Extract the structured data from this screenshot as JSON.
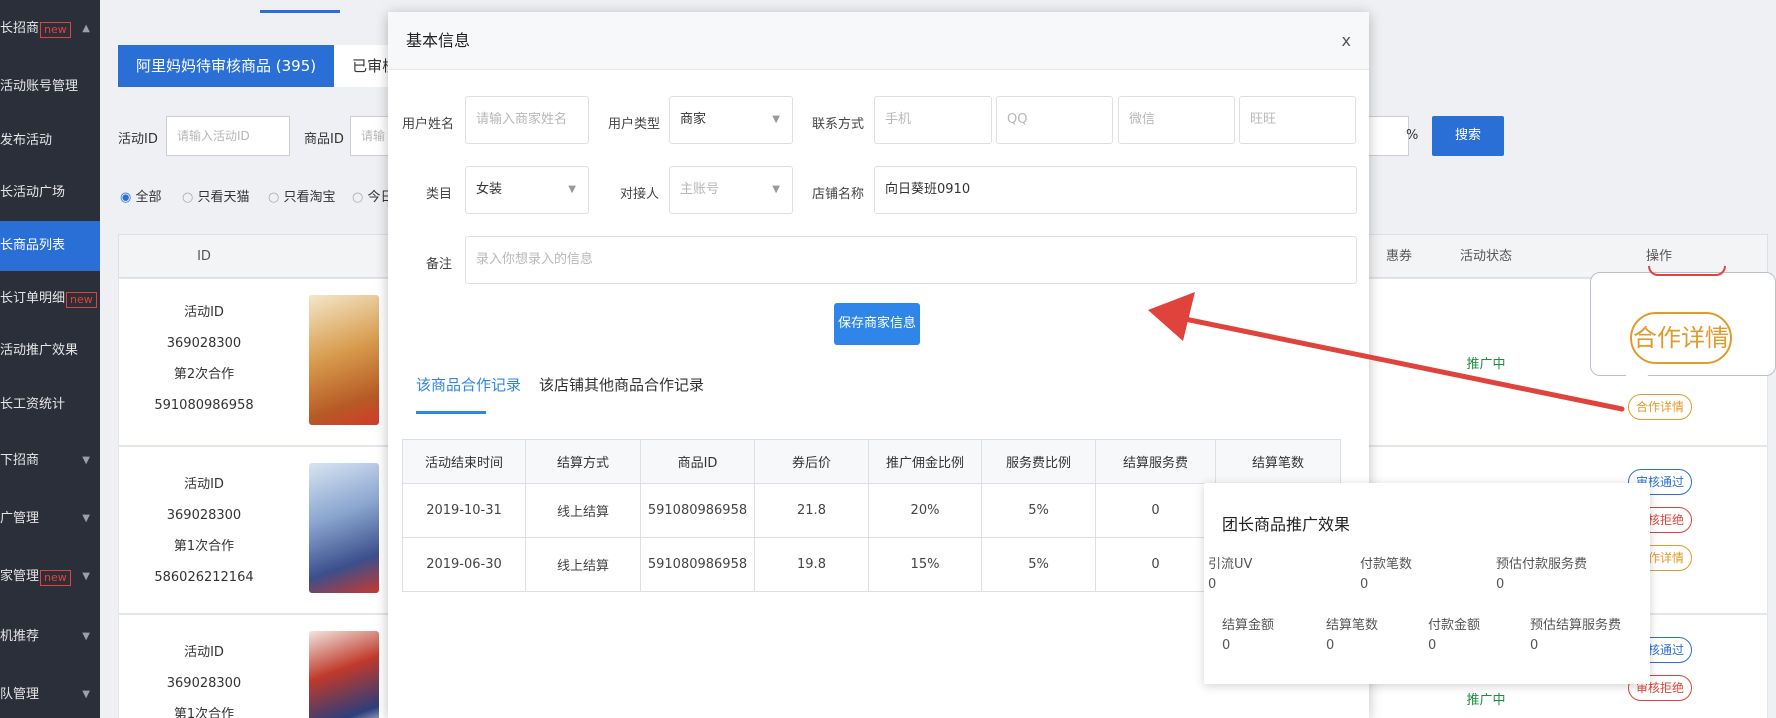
{
  "sidebar": {
    "items": [
      {
        "label": "长招商",
        "badge": "new",
        "caret": "▲",
        "active": false
      },
      {
        "label": "活动账号管理",
        "badge": "",
        "caret": "",
        "active": false
      },
      {
        "label": "发布活动",
        "badge": "",
        "caret": "",
        "active": false
      },
      {
        "label": "长活动广场",
        "badge": "",
        "caret": "",
        "active": false
      },
      {
        "label": "长商品列表",
        "badge": "",
        "caret": "",
        "active": true
      },
      {
        "label": "长订单明细",
        "badge": "new",
        "caret": "",
        "active": false
      },
      {
        "label": "活动推广效果",
        "badge": "",
        "caret": "",
        "active": false
      },
      {
        "label": "长工资统计",
        "badge": "",
        "caret": "",
        "active": false
      },
      {
        "label": "下招商",
        "badge": "",
        "caret": "▼",
        "active": false
      },
      {
        "label": "广管理",
        "badge": "",
        "caret": "▼",
        "active": false
      },
      {
        "label": "家管理",
        "badge": "new",
        "caret": "▼",
        "active": false
      },
      {
        "label": "机推荐",
        "badge": "",
        "caret": "▼",
        "active": false
      },
      {
        "label": "队管理",
        "badge": "",
        "caret": "▼",
        "active": false
      }
    ]
  },
  "background": {
    "tabs": [
      "阿里妈妈待审核商品 (395)",
      "已审核未"
    ],
    "filters": {
      "activity_id_label": "活动ID",
      "activity_id_placeholder": "请输入活动ID",
      "product_id_label": "商品ID",
      "product_id_placeholder": "请输",
      "percent": "%",
      "search_label": "搜索"
    },
    "radios": [
      "全部",
      "只看天猫",
      "只看淘宝",
      "今日"
    ],
    "headers": {
      "id": "ID",
      "coupon": "惠券",
      "status": "活动状态",
      "actions": "操作"
    },
    "rows": [
      {
        "lines": [
          "活动ID",
          "369028300",
          "第2次合作",
          "591080986958"
        ],
        "status": "推广中",
        "actions": [
          "合作详情"
        ]
      },
      {
        "lines": [
          "活动ID",
          "369028300",
          "第1次合作",
          "586026212164"
        ],
        "status": "",
        "actions": [
          "审核通过",
          "审核拒绝",
          "合作详情"
        ]
      },
      {
        "lines": [
          "活动ID",
          "369028300",
          "第1次合作"
        ],
        "status": "推广中",
        "actions": [
          "审核通过",
          "审核拒绝"
        ]
      }
    ],
    "callout_label": "合作详情"
  },
  "modal": {
    "title": "基本信息",
    "close": "x",
    "fields": {
      "username_label": "用户姓名",
      "username_placeholder": "请输入商家姓名",
      "user_type_label": "用户类型",
      "user_type_value": "商家",
      "contact_label": "联系方式",
      "phone_placeholder": "手机",
      "qq_placeholder": "QQ",
      "wechat_placeholder": "微信",
      "wangwang_placeholder": "旺旺",
      "category_label": "类目",
      "category_value": "女装",
      "contact_person_label": "对接人",
      "contact_person_placeholder": "主账号",
      "shop_name_label": "店铺名称",
      "shop_name_value": "向日葵班0910",
      "remark_label": "备注",
      "remark_placeholder": "录入你想录入的信息"
    },
    "save_label": "保存商家信息",
    "sub_tabs": [
      "该商品合作记录",
      "该店铺其他商品合作记录"
    ],
    "table": {
      "columns": [
        "活动结束时间",
        "结算方式",
        "商品ID",
        "券后价",
        "推广佣金比例",
        "服务费比例",
        "结算服务费",
        "结算笔数"
      ],
      "rows": [
        [
          "2019-10-31",
          "线上结算",
          "591080986958",
          "21.8",
          "20%",
          "5%",
          "0",
          ""
        ],
        [
          "2019-06-30",
          "线上结算",
          "591080986958",
          "19.8",
          "15%",
          "5%",
          "0",
          ""
        ]
      ]
    }
  },
  "popover": {
    "title": "团长商品推广效果",
    "row1": [
      {
        "label": "引流UV",
        "value": "0"
      },
      {
        "label": "付款笔数",
        "value": "0"
      },
      {
        "label": "预估付款服务费",
        "value": "0"
      }
    ],
    "row2": [
      {
        "label": "结算金额",
        "value": "0"
      },
      {
        "label": "结算笔数",
        "value": "0"
      },
      {
        "label": "付款金额",
        "value": "0"
      },
      {
        "label": "预估结算服务费",
        "value": "0"
      }
    ]
  },
  "colors": {
    "primary": "#2a6fd6",
    "annotation_red": "#e0433b",
    "accent_orange": "#e29a2c",
    "status_green": "#1e8e3e"
  }
}
